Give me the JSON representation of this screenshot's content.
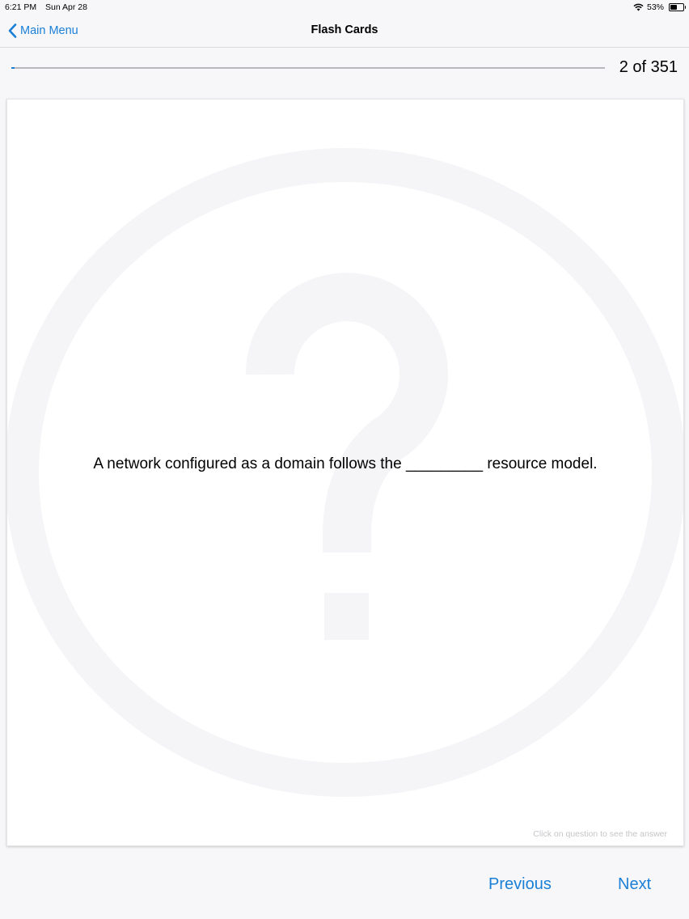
{
  "status_bar": {
    "time": "6:21 PM",
    "date": "Sun Apr 28",
    "battery_percent": "53%",
    "battery_level": 0.53,
    "wifi_icon": "wifi-icon",
    "battery_icon": "battery-icon"
  },
  "nav": {
    "back_label": "Main Menu",
    "back_icon": "chevron-left-icon",
    "title": "Flash Cards"
  },
  "progress": {
    "current": 2,
    "total": 351,
    "label": "2 of 351",
    "accent_color": "#1a7fd6"
  },
  "card": {
    "question": "A network configured as a domain follows the _________ resource model.",
    "hint": "Click on question to see the answer",
    "watermark_icon": "question-mark-icon"
  },
  "footer": {
    "previous_label": "Previous",
    "next_label": "Next"
  }
}
